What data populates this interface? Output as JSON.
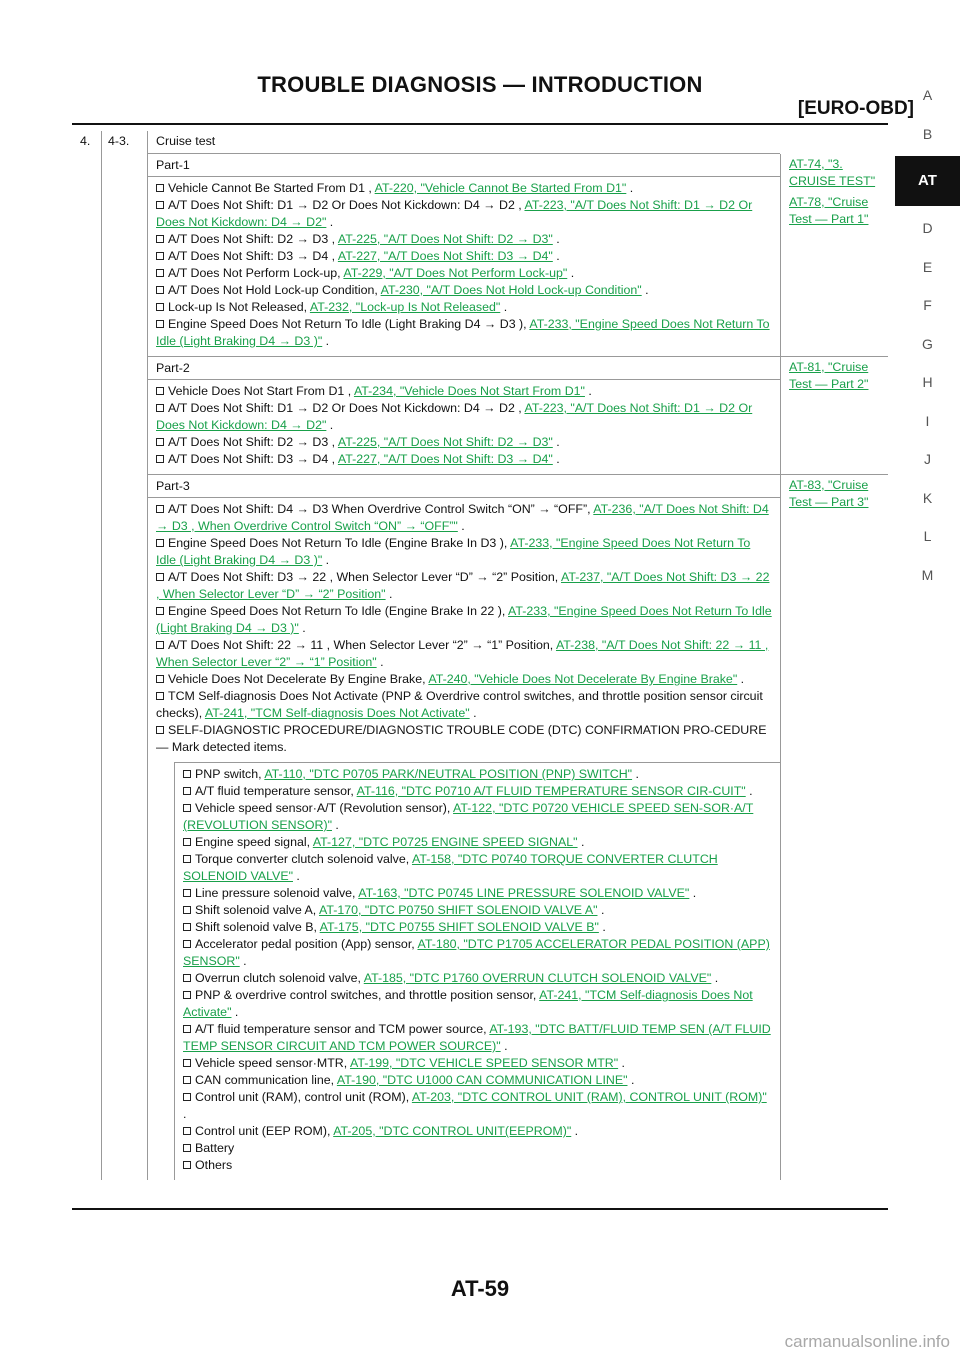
{
  "header": {
    "title": "TROUBLE DIAGNOSIS — INTRODUCTION",
    "subtitle": "[EURO-OBD]"
  },
  "side_index": [
    "A",
    "B",
    "AT",
    "D",
    "E",
    "F",
    "G",
    "H",
    "I",
    "J",
    "K",
    "L",
    "M"
  ],
  "row": {
    "number": "4.",
    "step": "4-3.",
    "title": "Cruise test"
  },
  "parts": [
    {
      "title": "Part-1",
      "ref": [
        "AT-74, \"3. CRUISE TEST\"",
        "AT-78, \"Cruise Test — Part 1\""
      ],
      "items": [
        {
          "text": "Vehicle Cannot Be Started From D1 , ",
          "link": "AT-220, \"Vehicle Cannot Be Started From D1\"",
          "tail": " ."
        },
        {
          "text": "A/T Does Not Shift: D1 → D2 Or Does Not Kickdown: D4 → D2 , ",
          "link": "AT-223, \"A/T Does Not Shift: D1 → D2 Or Does Not Kickdown: D4 → D2\"",
          "tail": " ."
        },
        {
          "text": "A/T Does Not Shift: D2 → D3 , ",
          "link": "AT-225, \"A/T Does Not Shift: D2 → D3\"",
          "tail": " ."
        },
        {
          "text": "A/T Does Not Shift: D3 → D4 , ",
          "link": "AT-227, \"A/T Does Not Shift: D3 → D4\"",
          "tail": " ."
        },
        {
          "text": "A/T Does Not Perform Lock-up, ",
          "link": "AT-229, \"A/T Does Not Perform Lock-up\"",
          "tail": " ."
        },
        {
          "text": "A/T Does Not Hold Lock-up Condition, ",
          "link": "AT-230, \"A/T Does Not Hold Lock-up Condition\"",
          "tail": " ."
        },
        {
          "text": "Lock-up Is Not Released, ",
          "link": "AT-232, \"Lock-up Is Not Released\"",
          "tail": " ."
        },
        {
          "text": "Engine Speed Does Not Return To Idle (Light Braking D4 → D3 ), ",
          "link": "AT-233, \"Engine Speed Does Not Return To Idle (Light Braking D4 → D3 )\"",
          "tail": " ."
        }
      ]
    },
    {
      "title": "Part-2",
      "ref": [
        "AT-81, \"Cruise Test — Part 2\""
      ],
      "items": [
        {
          "text": "Vehicle Does Not Start From D1 , ",
          "link": "AT-234, \"Vehicle Does Not Start From D1\"",
          "tail": " ."
        },
        {
          "text": "A/T Does Not Shift: D1 → D2 Or Does Not Kickdown: D4 → D2 , ",
          "link": "AT-223, \"A/T Does Not Shift: D1 → D2 Or Does Not Kickdown: D4 → D2\"",
          "tail": " ."
        },
        {
          "text": "A/T Does Not Shift: D2 → D3 , ",
          "link": "AT-225, \"A/T Does Not Shift: D2 → D3\"",
          "tail": " ."
        },
        {
          "text": "A/T Does Not Shift: D3 → D4 , ",
          "link": "AT-227, \"A/T Does Not Shift: D3 → D4\"",
          "tail": " ."
        }
      ]
    },
    {
      "title": "Part-3",
      "ref": [
        "AT-83, \"Cruise Test — Part 3\""
      ],
      "items": [
        {
          "text": "A/T Does Not Shift: D4 → D3 When Overdrive Control Switch “ON” → “OFF”, ",
          "link": "AT-236, \"A/T Does Not Shift: D4 → D3 , When Overdrive Control Switch “ON” → “OFF”\"",
          "tail": " ."
        },
        {
          "text": "Engine Speed Does Not Return To Idle (Engine Brake In D3 ), ",
          "link": "AT-233, \"Engine Speed Does Not Return To Idle (Light Braking D4 → D3 )\"",
          "tail": " ."
        },
        {
          "text": "A/T Does Not Shift: D3 → 22 , When Selector Lever “D” → “2” Position, ",
          "link": "AT-237, \"A/T Does Not Shift: D3 → 22 , When Selector Lever “D” → “2” Position\"",
          "tail": " ."
        },
        {
          "text": "Engine Speed Does Not Return To Idle (Engine Brake In 22 ), ",
          "link": "AT-233, \"Engine Speed Does Not Return To Idle (Light Braking D4 → D3 )\"",
          "tail": " ."
        },
        {
          "text": "A/T Does Not Shift: 22 → 11 , When Selector Lever “2” → “1” Position, ",
          "link": "AT-238, \"A/T Does Not Shift: 22 → 11 , When Selector Lever “2” → “1” Position\"",
          "tail": " ."
        },
        {
          "text": "Vehicle Does Not Decelerate By Engine Brake, ",
          "link": "AT-240, \"Vehicle Does Not Decelerate By Engine Brake\"",
          "tail": " ."
        },
        {
          "text": "TCM Self-diagnosis Does Not Activate (PNP & Overdrive control switches, and throttle position sensor circuit checks), ",
          "link": "AT-241, \"TCM Self-diagnosis Does Not Activate\"",
          "tail": " ."
        },
        {
          "text": "SELF-DIAGNOSTIC PROCEDURE/DIAGNOSTIC TROUBLE CODE (DTC) CONFIRMATION PRO-CEDURE — Mark detected items.",
          "link": "",
          "tail": ""
        }
      ]
    }
  ],
  "dtc_items": [
    {
      "text": "PNP switch, ",
      "link": "AT-110, \"DTC P0705 PARK/NEUTRAL POSITION (PNP) SWITCH\"",
      "tail": " ."
    },
    {
      "text": "A/T fluid temperature sensor, ",
      "link": "AT-116, \"DTC P0710 A/T FLUID TEMPERATURE SENSOR CIR-CUIT\"",
      "tail": " ."
    },
    {
      "text": "Vehicle speed sensor·A/T (Revolution sensor), ",
      "link": "AT-122, \"DTC P0720 VEHICLE SPEED SEN-SOR·A/T (REVOLUTION SENSOR)\"",
      "tail": " ."
    },
    {
      "text": "Engine speed signal, ",
      "link": "AT-127, \"DTC P0725 ENGINE SPEED SIGNAL\"",
      "tail": " ."
    },
    {
      "text": "Torque converter clutch solenoid valve, ",
      "link": "AT-158, \"DTC P0740 TORQUE CONVERTER CLUTCH SOLENOID VALVE\"",
      "tail": " ."
    },
    {
      "text": "Line pressure solenoid valve, ",
      "link": "AT-163, \"DTC P0745 LINE PRESSURE SOLENOID VALVE\"",
      "tail": " ."
    },
    {
      "text": "Shift solenoid valve A, ",
      "link": "AT-170, \"DTC P0750 SHIFT SOLENOID VALVE A\"",
      "tail": " ."
    },
    {
      "text": "Shift solenoid valve B, ",
      "link": "AT-175, \"DTC P0755 SHIFT SOLENOID VALVE B\"",
      "tail": " ."
    },
    {
      "text": "Accelerator pedal position (App) sensor, ",
      "link": "AT-180, \"DTC P1705 ACCELERATOR PEDAL POSITION (APP) SENSOR\"",
      "tail": " ."
    },
    {
      "text": "Overrun clutch solenoid valve, ",
      "link": "AT-185, \"DTC P1760 OVERRUN CLUTCH SOLENOID VALVE\"",
      "tail": " ."
    },
    {
      "text": "PNP & overdrive control switches, and throttle position sensor, ",
      "link": "AT-241, \"TCM Self-diagnosis Does Not Activate\"",
      "tail": " ."
    },
    {
      "text": "A/T fluid temperature sensor and TCM power source, ",
      "link": "AT-193, \"DTC BATT/FLUID TEMP SEN (A/T FLUID TEMP SENSOR CIRCUIT AND TCM POWER SOURCE)\"",
      "tail": " ."
    },
    {
      "text": "Vehicle speed sensor·MTR, ",
      "link": "AT-199, \"DTC VEHICLE SPEED SENSOR MTR\"",
      "tail": " ."
    },
    {
      "text": "CAN communication line, ",
      "link": "AT-190, \"DTC U1000 CAN COMMUNICATION LINE\"",
      "tail": " ."
    },
    {
      "text": "Control unit (RAM), control unit (ROM), ",
      "link": "AT-203, \"DTC CONTROL UNIT (RAM), CONTROL UNIT (ROM)\"",
      "tail": " ."
    },
    {
      "text": "Control unit (EEP ROM), ",
      "link": "AT-205, \"DTC CONTROL UNIT(EEPROM)\"",
      "tail": " ."
    },
    {
      "text": "Battery",
      "link": "",
      "tail": ""
    },
    {
      "text": "Others",
      "link": "",
      "tail": ""
    }
  ],
  "footer": {
    "page": "AT-59",
    "watermark": "carmanualsonline.info"
  },
  "colors": {
    "link": "#19a04a",
    "tab_active": "#111111"
  }
}
